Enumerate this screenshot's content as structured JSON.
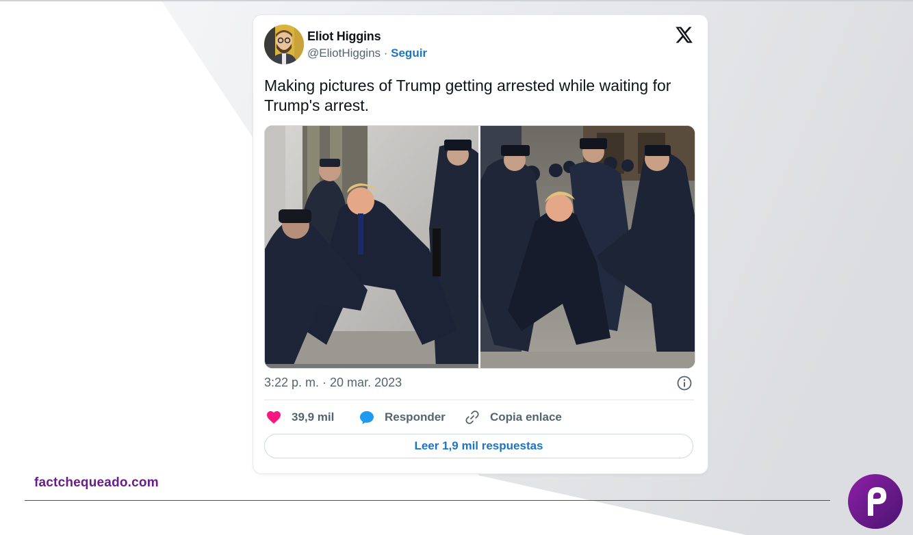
{
  "tweet": {
    "author_name": "Eliot Higgins",
    "handle": "@EliotHiggins",
    "separator": " · ",
    "follow_label": "Seguir",
    "text": "Making pictures of Trump getting arrested while waiting for Trump's arrest.",
    "timestamp": "3:22 p. m. · 20 mar. 2023",
    "likes": "39,9 mil",
    "reply_label": "Responder",
    "copy_label": "Copia enlace",
    "read_replies_label": "Leer 1,9 mil respuestas"
  },
  "footer": {
    "site": "factchequeado.com"
  },
  "colors": {
    "accent_blue": "#1d74c4",
    "like_pink": "#f91880",
    "reply_blue": "#1d9bf0",
    "brand_purple": "#6a1b8c"
  },
  "icons": [
    "x-logo-icon",
    "info-icon",
    "heart-icon",
    "speech-bubble-icon",
    "link-icon",
    "factchequeado-logo"
  ]
}
